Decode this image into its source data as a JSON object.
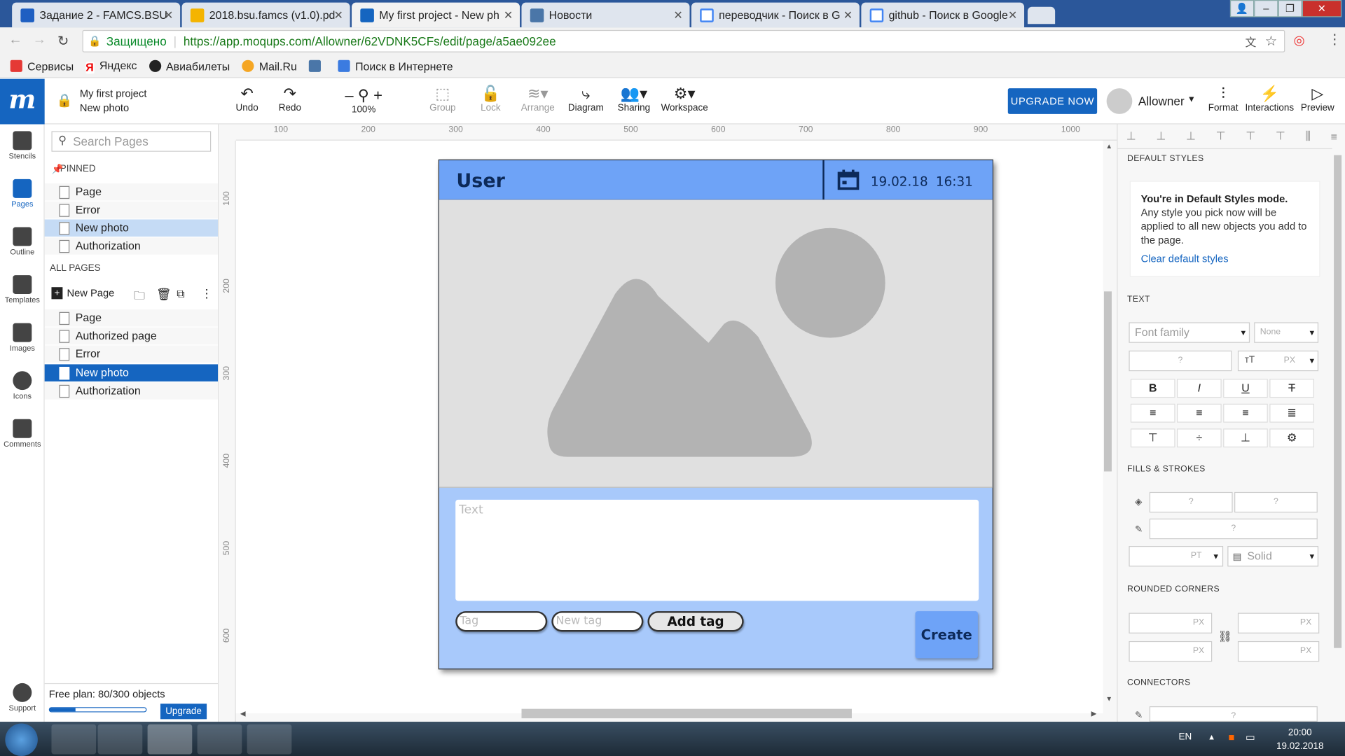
{
  "browser": {
    "tabs": [
      {
        "label": "Задание 2 - FAMCS.BSU"
      },
      {
        "label": "2018.bsu.famcs (v1.0).pd"
      },
      {
        "label": "My first project - New ph"
      },
      {
        "label": "Новости"
      },
      {
        "label": "переводчик - Поиск в G"
      },
      {
        "label": "github - Поиск в Google"
      }
    ],
    "security_label": "Защищено",
    "url": "https://app.moqups.com/Allowner/62VDNK5CFs/edit/page/a5ae092ee",
    "bookmarks": [
      "Сервисы",
      "Яндекс",
      "Авиабилеты",
      "Mail.Ru",
      "Поиск в Интернете"
    ]
  },
  "app": {
    "project_name": "My first project",
    "page_name": "New photo",
    "toolbar": {
      "undo": "Undo",
      "redo": "Redo",
      "zoom": "100%",
      "group": "Group",
      "lock": "Lock",
      "arrange": "Arrange",
      "diagram": "Diagram",
      "sharing": "Sharing",
      "workspace": "Workspace",
      "upgrade_now": "UPGRADE NOW",
      "username": "Allowner",
      "format": "Format",
      "interactions": "Interactions",
      "preview": "Preview"
    },
    "rail": [
      "Stencils",
      "Pages",
      "Outline",
      "Templates",
      "Images",
      "Icons",
      "Comments",
      "Support"
    ],
    "pages_panel": {
      "search_placeholder": "Search Pages",
      "pinned_label": "PINNED",
      "pinned": [
        "Page",
        "Error",
        "New photo",
        "Authorization"
      ],
      "all_label": "ALL PAGES",
      "new_page": "New Page",
      "all": [
        "Page",
        "Authorized page",
        "Error",
        "New photo",
        "Authorization"
      ],
      "plan_text": "Free plan: 80/300 objects",
      "plan_progress": 0.27,
      "upgrade": "Upgrade"
    },
    "ruler_h": [
      "100",
      "200",
      "300",
      "400",
      "500",
      "600",
      "700",
      "800",
      "900",
      "1000"
    ],
    "ruler_v": [
      "100",
      "200",
      "300",
      "400",
      "500",
      "600"
    ],
    "mockup": {
      "title": "User",
      "date": "19.02.18",
      "time": "16:31",
      "text_placeholder": "Text",
      "tag_placeholder": "Tag",
      "new_tag_placeholder": "New tag",
      "add_tag": "Add tag",
      "create": "Create",
      "colors": {
        "header": "#6ea3f7",
        "body": "#a8c9fb",
        "text": "#0d2a59"
      }
    },
    "right_panel": {
      "default_styles_head": "DEFAULT STYLES",
      "default_title": "You're in Default Styles mode.",
      "default_body": "Any style you pick now will be applied to all new objects you add to the page.",
      "clear_link": "Clear default styles",
      "text_head": "TEXT",
      "font_family": "Font family",
      "font_weight": "None",
      "unknown": "?",
      "px": "PX",
      "pt": "PT",
      "fills_head": "FILLS & STROKES",
      "stroke_style": "Solid",
      "rounded_head": "ROUNDED CORNERS",
      "connectors_head": "CONNECTORS"
    }
  },
  "taskbar": {
    "lang": "EN",
    "time": "20:00",
    "date": "19.02.2018"
  }
}
